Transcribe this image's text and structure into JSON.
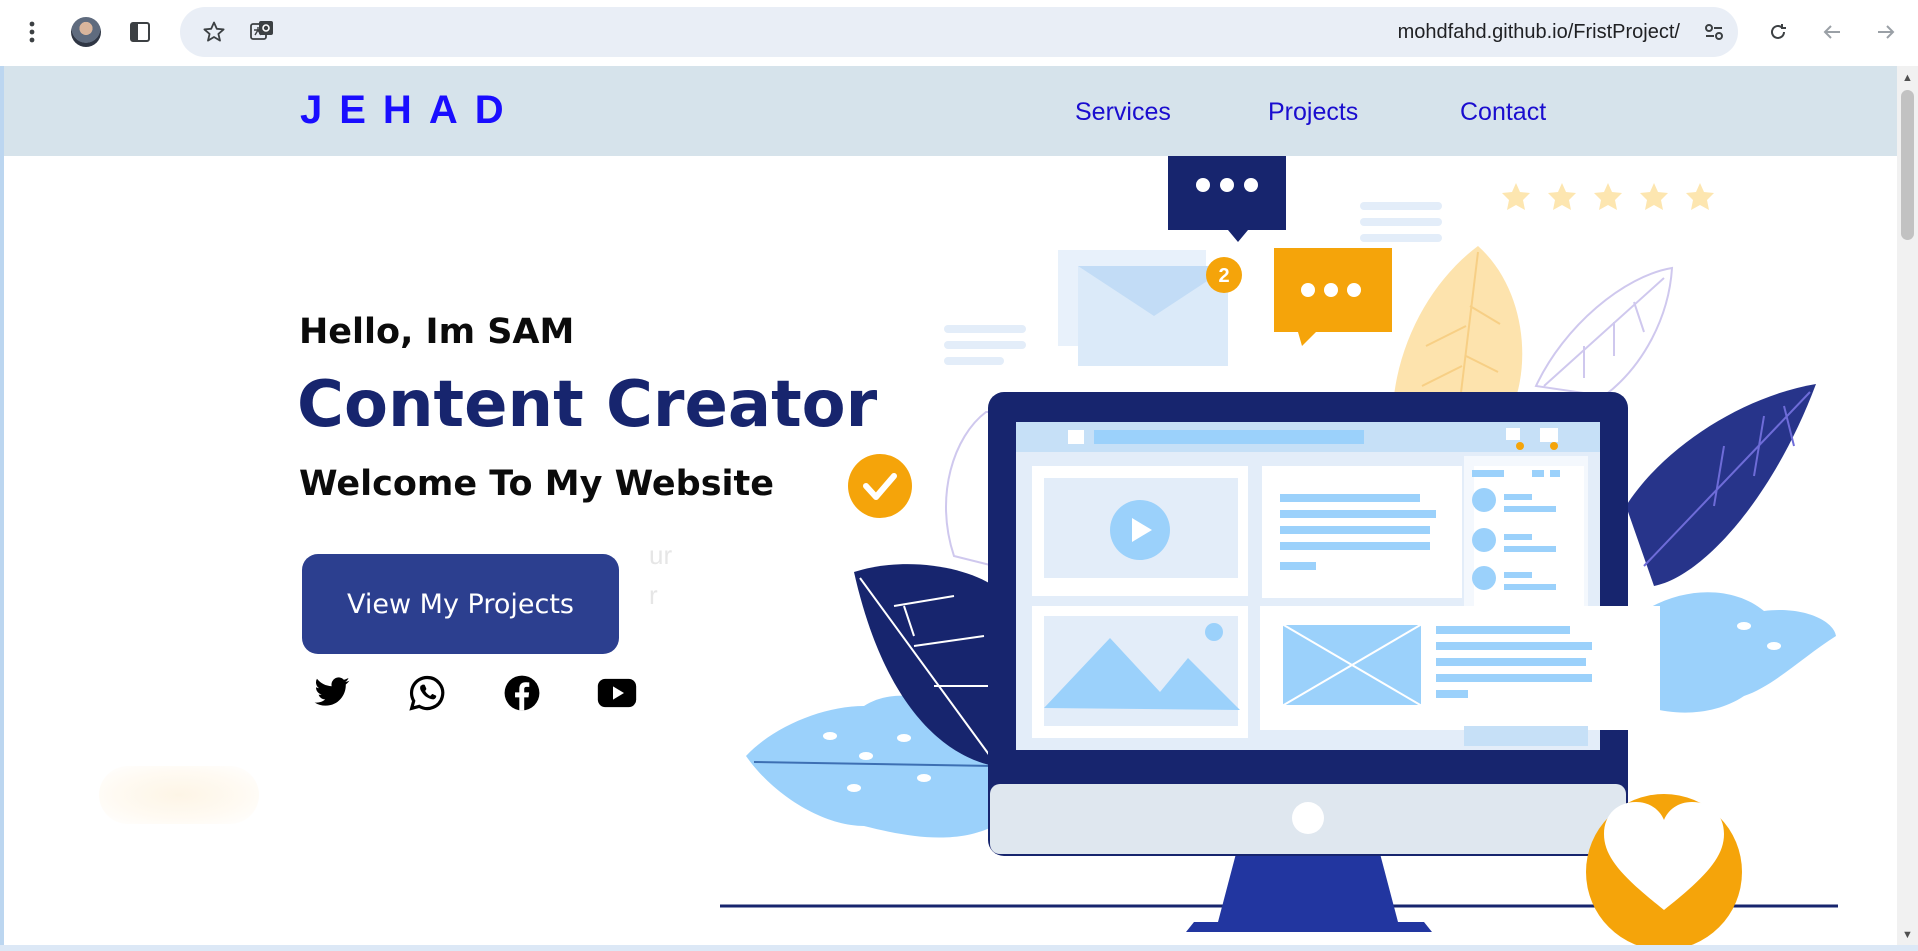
{
  "browser": {
    "url": "mohdfahd.github.io/FristProject/",
    "icons": [
      "more-vert-icon",
      "profile-avatar",
      "side-panel-icon",
      "bookmark-star-icon",
      "translate-icon",
      "site-settings-icon",
      "reload-icon",
      "back-icon",
      "forward-icon"
    ]
  },
  "nav": {
    "logo": "JEHAD",
    "links": [
      "Services",
      "Projects",
      "Contact"
    ]
  },
  "hero": {
    "greeting": "Hello, Im SAM",
    "title": "Content Creator",
    "subtitle": "Welcome To My Website",
    "ghost_line1": "ur",
    "ghost_line2": "r",
    "cta": "View My Projects",
    "social_icons": [
      "twitter-icon",
      "whatsapp-icon",
      "facebook-icon",
      "youtube-icon"
    ]
  },
  "illustration": {
    "notification_badge": "2",
    "colors": {
      "navy": "#17256e",
      "orange": "#f5a40a",
      "light_blue": "#9bd1fb",
      "pale_blue": "#dbeaf9"
    }
  }
}
